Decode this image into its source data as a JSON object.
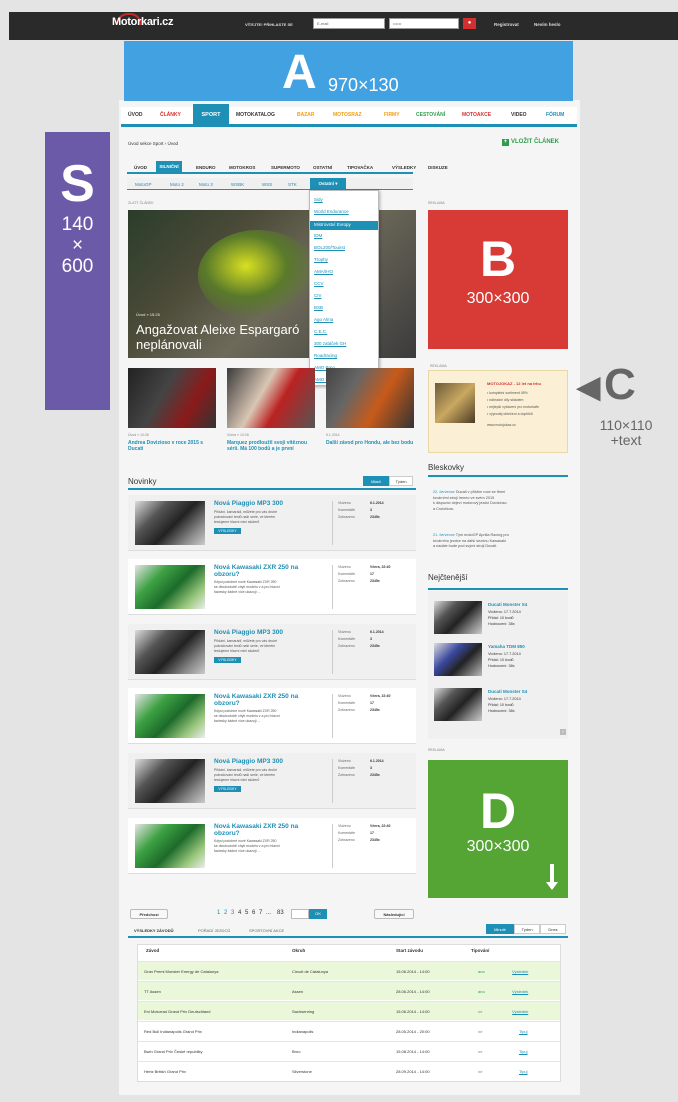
{
  "header": {
    "logo": "Motorkari.cz",
    "login_label": "VÍTEJTE! PŘIHLASTE SE",
    "email_placeholder": "E-mail",
    "password_placeholder": "••••••",
    "register": "Registrovat",
    "forgot": "Nevím heslo"
  },
  "banners": {
    "a": {
      "letter": "A",
      "size": "970×130"
    },
    "s": {
      "letter": "S",
      "size": [
        "140",
        "×",
        "600"
      ]
    },
    "b": {
      "letter": "B",
      "size": "300×300"
    },
    "c": {
      "letter": "C",
      "size": [
        "110×110",
        "+text"
      ]
    },
    "d": {
      "letter": "D",
      "size": "300×300"
    }
  },
  "main_nav": [
    "ÚVOD",
    "ČLÁNKY",
    "SPORT",
    "MOTOKATALOG",
    "BAZAR",
    "MOTOSRAZ",
    "FIRMY",
    "CESTOVÁNÍ",
    "MOTOAKCE",
    "VIDEO",
    "FÓRUM"
  ],
  "breadcrumb": "Úvod sekce Sport  ›  Úvod",
  "add_article": "VLOŽIT ČLÁNEK",
  "sub_nav": [
    "ÚVOD",
    "SILNIČNÍ",
    "ENDURO",
    "MOTOKROS",
    "SUPERMOTO",
    "OSTATNÍ",
    "TIPOVAČKA",
    "VÝSLEDKY",
    "DISKUZE"
  ],
  "sub_sub_nav": [
    "MotoGP",
    "Moto 2",
    "Moto 3",
    "WSBK",
    "WSS",
    "STK",
    "Ostatní"
  ],
  "dropdown": [
    "Sidy",
    "World Endurance",
    "Mistrovství Evropy",
    "IDM",
    "BOL200/Touirst",
    "Trophy",
    "AMA/IHO",
    "CCV",
    "CIV",
    "BSB",
    "Ago Alma",
    "C.E.C.",
    "300 zatáček GH",
    "Roadracing",
    "AMO Brno",
    "AMO Most"
  ],
  "labels": {
    "zpravy": "ZLATÝ ČLÁNEK",
    "reklama": "REKLAMA"
  },
  "hero": {
    "meta": "Úvod » 15:25",
    "title": [
      "Angažovat Aleixe Espargaró",
      "neplánovali"
    ]
  },
  "thumbs": [
    {
      "meta": "Úvod » 10:26",
      "title": "Andrea Dovizioso v roce 2015 s Ducati"
    },
    {
      "meta": "Včera » 10:26",
      "title": "Marquez prodloužil svoji vítěznou sérii. Má 100 bodů a je první"
    },
    {
      "meta": "5.1.2014",
      "title": "Další závod pro Hondu, ale bez bodu"
    }
  ],
  "novinky": {
    "title": "Novinky",
    "tabs": [
      "Mladí",
      "Týden"
    ]
  },
  "news": [
    {
      "title": "Nová Piaggio MP3 300",
      "desc": [
        "Přidáni, kamarádi, můžete pro vás druhé",
        "pokračování testů naší serie, ve kterém",
        "testujeme hlavní mini skúterů"
      ],
      "tag": "VÝSLEDKY",
      "date": "6.1.2014",
      "comments": "3",
      "views": "2345x"
    },
    {
      "title": "Nová Kawasaki ZXR 250 na obzoru?",
      "desc": [
        "Kdysi podobné nové Kawasaki ZXR 250",
        "se dlouhodobě chytí modelu v a pro hlavní",
        "faciesky žádné více ukazují ..."
      ],
      "tag": "",
      "date": "Včera, 22:40",
      "comments": "17",
      "views": "2345x"
    },
    {
      "title": "Nová Piaggio MP3 300",
      "desc": [
        "Přidáni, kamarádi, můžete pro vás druhé",
        "pokračování testů naší serie, ve kterém",
        "testujeme hlavní mini skúterů"
      ],
      "tag": "VÝSLEDKY",
      "date": "6.1.2014",
      "comments": "3",
      "views": "2345x"
    },
    {
      "title": "Nová Kawasaki ZXR 250 na obzoru?",
      "desc": [
        "Kdysi podobné nové Kawasaki ZXR 250",
        "se dlouhodobě chytí modelu v a pro hlavní",
        "faciesky žádné více ukazují ..."
      ],
      "tag": "",
      "date": "Včera, 22:40",
      "comments": "17",
      "views": "2345x"
    },
    {
      "title": "Nová Piaggio MP3 300",
      "desc": [
        "Přidáni, kamarádi, můžete pro vás druhé",
        "pokračování testů naší serie, ve kterém",
        "testujeme hlavní mini skúterů"
      ],
      "tag": "VÝSLEDKY",
      "date": "6.1.2014",
      "comments": "3",
      "views": "2345x"
    },
    {
      "title": "Nová Kawasaki ZXR 250 na obzoru?",
      "desc": [
        "Kdysi podobné nové Kawasaki ZXR 250",
        "se dlouhodobě chytí modelu v a pro hlavní",
        "faciesky žádné více ukazují ..."
      ],
      "tag": "",
      "date": "Včera, 22:40",
      "comments": "17",
      "views": "2345x"
    }
  ],
  "news_labels": {
    "date": "Vloženo",
    "comments": "Komentáře",
    "views": "Zobrazeno"
  },
  "promo": {
    "title": "MOTOJOKAZ - 12 let na trhu",
    "lines": [
      "• kompletní sortiment 45%",
      "• náhradní díly skladem",
      "• nejlepší vybavení pro motorkáře",
      "• výprodej oblečení a doplňků",
      "www.motojokaz.cz"
    ]
  },
  "bleskovky": {
    "title": "Bleskovky",
    "items": [
      {
        "date": "22. července",
        "text": [
          "Ducati v příštím roce se třemi",
          "továrními stroji Ireneo ve svém 2015",
          "k dispozici objeví motorový jezdci Dovizioso",
          "a Crutchlow."
        ]
      },
      {
        "date": "21. července",
        "text": [
          "Tým motoGP Aprilia Racing pro",
          "továrního jezdce na další sezónu Kawasaki",
          "a nadále bude pod svými stroji Ducati."
        ]
      }
    ]
  },
  "nejctenejsi": {
    "title": "Nejčtenější",
    "items": [
      {
        "title": "Ducati Monster S4",
        "lines": [
          "Vloženo: 17.7.2014",
          "Přidal: 10 bodů",
          "Hodnocení: 38x"
        ]
      },
      {
        "title": "Yamaha TDM 850",
        "lines": [
          "Vloženo: 17.7.2014",
          "Přidal: 10 bodů",
          "Hodnocení: 38x"
        ]
      },
      {
        "title": "Ducati Monster S4",
        "lines": [
          "Vloženo: 17.7.2014",
          "Přidal: 10 bodů",
          "Hodnocení: 38x"
        ]
      }
    ]
  },
  "pagination": {
    "prev": "Předchozí",
    "pages": [
      "1",
      "2",
      "3",
      "4",
      "5",
      "6",
      "7",
      "...",
      "83"
    ],
    "ok": "OK",
    "next": "Následující"
  },
  "results_tabs": [
    "VÝSLEDKY ZÁVODŮ",
    "POŘADÍ JEZDCŮ",
    "SPORTOVNÍ AKCE"
  ],
  "results_filter": [
    "Minulé",
    "Týden",
    "Dnes"
  ],
  "results_headers": [
    "Závod",
    "Okruh",
    "Start závodu",
    "Tipování",
    ""
  ],
  "results": [
    {
      "race": "Gran Premi Monster Energy de Catalunya",
      "circuit": "Circuit de Catalunya",
      "start": "15.06.2014 - 14:00",
      "tip": "ano",
      "link": "Výsledek",
      "green": true
    },
    {
      "race": "TT Assen",
      "circuit": "Assen",
      "start": "28.06.2014 - 14:00",
      "tip": "ano",
      "link": "Výsledek",
      "green": true
    },
    {
      "race": "Eni Motorrad Grand Prix Deutschland",
      "circuit": "Sachsenring",
      "start": "15.06.2014 - 14:00",
      "tip": "ne",
      "link": "Výsledek",
      "green": true
    },
    {
      "race": "Red Bull Indianapolis Grand Prix",
      "circuit": "Indianapolis",
      "start": "28.05.2014 - 20:00",
      "tip": "ne",
      "link": "Tipuj",
      "green": false
    },
    {
      "race": "Bwin Grand Prix České republiky",
      "circuit": "Brno",
      "start": "15.08.2014 - 14:00",
      "tip": "ne",
      "link": "Tipuj",
      "green": false
    },
    {
      "race": "Hertz British Grand Prix",
      "circuit": "Silverstone",
      "start": "28.09.2014 - 14:00",
      "tip": "ne",
      "link": "Tipuj",
      "green": false
    }
  ],
  "colors": {
    "teal": "#1e8fb5",
    "bannerA": "#42a1e0",
    "bannerS": "#6b5aa8",
    "bannerB": "#d83a36",
    "bannerD": "#55a534"
  }
}
